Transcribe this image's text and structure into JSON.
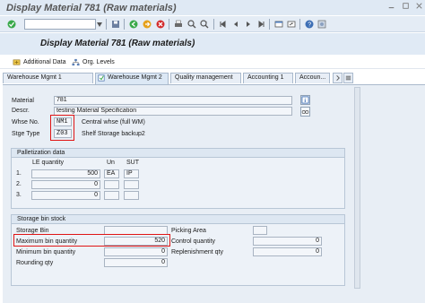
{
  "window": {
    "title": "Display Material 781 (Raw materials)"
  },
  "toolbar": {
    "command_field": "",
    "icons": [
      "enter-icon",
      "save-icon",
      "back-icon",
      "exit-icon",
      "cancel-icon",
      "print-icon",
      "find-icon",
      "find-next-icon",
      "first-page-icon",
      "prev-page-icon",
      "next-page-icon",
      "last-page-icon",
      "new-session-icon",
      "shortcut-icon",
      "help-icon",
      "layout-icon"
    ]
  },
  "header": {
    "title": "Display Material 781 (Raw materials)"
  },
  "app_toolbar": {
    "additional_data": "Additional Data",
    "org_levels": "Org. Levels"
  },
  "tabs": [
    {
      "label": "Warehouse Mgmt 1"
    },
    {
      "label": "Warehouse Mgmt 2"
    },
    {
      "label": "Quality management"
    },
    {
      "label": "Accounting 1"
    },
    {
      "label": "Accoun..."
    }
  ],
  "material": {
    "material_label": "Material",
    "material_value": "781",
    "descr_label": "Descr.",
    "descr_value": "testing Material Specification",
    "whse_label": "Whse No.",
    "whse_value": "NM1",
    "whse_text": "Central whse (full WM)",
    "stge_label": "Stge Type",
    "stge_value": "Z03",
    "stge_text": "Shelf Storage backup2"
  },
  "palletization": {
    "title": "Palletization data",
    "col_le": "LE quantity",
    "col_un": "Un",
    "col_sut": "SUT",
    "rows": [
      {
        "idx": "1.",
        "qty": "500",
        "un": "EA",
        "sut": "IP"
      },
      {
        "idx": "2.",
        "qty": "0",
        "un": "",
        "sut": ""
      },
      {
        "idx": "3.",
        "qty": "0",
        "un": "",
        "sut": ""
      }
    ]
  },
  "storage": {
    "title": "Storage bin stock",
    "storage_bin_label": "Storage Bin",
    "storage_bin_value": "",
    "picking_area_label": "Picking Area",
    "picking_area_value": "",
    "max_bin_label": "Maximum bin quantity",
    "max_bin_value": "520",
    "control_qty_label": "Control quantity",
    "control_qty_value": "0",
    "min_bin_label": "Minimum bin quantity",
    "min_bin_value": "0",
    "replenish_label": "Replenishment qty",
    "replenish_value": "0",
    "rounding_label": "Rounding qty",
    "rounding_value": "0"
  },
  "colors": {
    "highlight": "#e01515",
    "accent": "#dfe9f4"
  }
}
